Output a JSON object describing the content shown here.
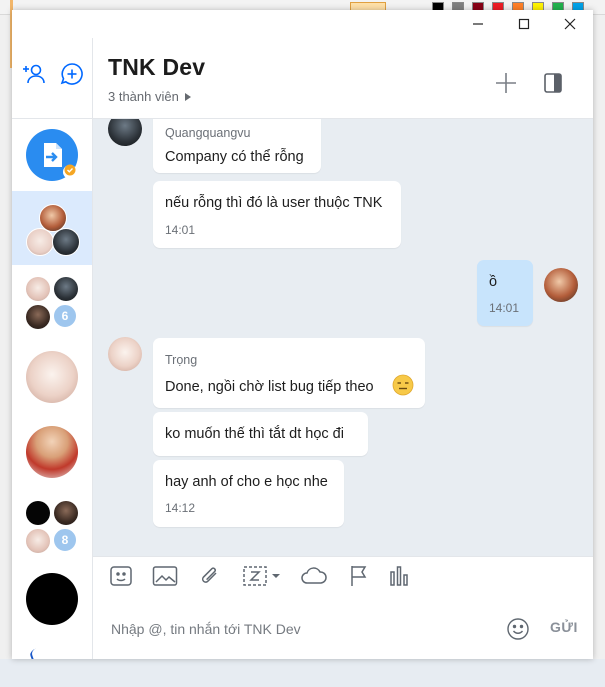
{
  "colors": {
    "accent": "#0068ff",
    "active_bg": "#dbeafd",
    "my_bubble": "#c8e4fc",
    "badge": "#9ec6ee",
    "chat_bg": "#e8edf2"
  },
  "window": {
    "controls": [
      "minimize-icon",
      "maximize-icon",
      "close-icon"
    ]
  },
  "rail": {
    "top_icons": [
      "add-friend-icon",
      "new-chat-icon"
    ],
    "conversations": [
      {
        "type": "cloud-transfer",
        "icon": "file-transfer-icon",
        "verified": true
      },
      {
        "type": "group",
        "active": true
      },
      {
        "type": "group",
        "badge": "6"
      },
      {
        "type": "single"
      },
      {
        "type": "single"
      },
      {
        "type": "group",
        "badge": "8"
      },
      {
        "type": "single"
      }
    ]
  },
  "header": {
    "title": "TNK Dev",
    "members": "3 thành viên",
    "icons": [
      "add-member-icon",
      "toggle-panel-icon"
    ]
  },
  "messages": [
    {
      "sender": "Quangquangvu",
      "text": "Company có thể rỗng",
      "time": ""
    },
    {
      "sender": "",
      "text": "nếu rỗng thì đó là user thuộc TNK",
      "time": "14:01"
    },
    {
      "sender": "me",
      "text": "ồ",
      "time": "14:01"
    },
    {
      "sender": "Trọng",
      "text": "Done, ngồi chờ list bug tiếp theo",
      "time": "",
      "emoji": "expressionless-emoji"
    },
    {
      "sender": "",
      "text": "ko muốn thế thì tắt dt học đi",
      "time": ""
    },
    {
      "sender": "",
      "text": "hay anh of cho e học nhe",
      "time": "14:12"
    }
  ],
  "toolbar": {
    "tools": [
      "sticker-icon",
      "image-icon",
      "attachment-icon",
      "screenshot-icon",
      "cloud-icon",
      "flag-icon",
      "poll-icon"
    ]
  },
  "composer": {
    "placeholder": "Nhập @, tin nhắn tới TNK Dev",
    "send_label": "GỬI"
  }
}
